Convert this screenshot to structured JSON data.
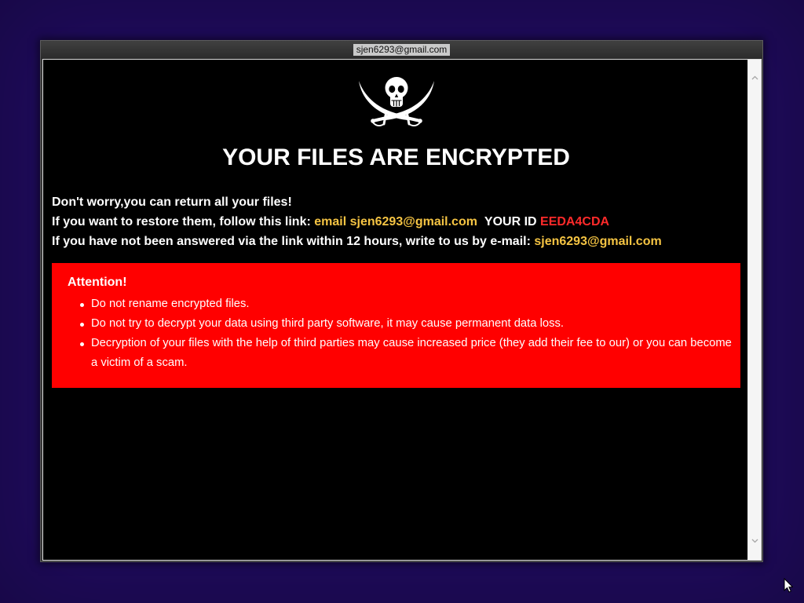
{
  "window": {
    "title": "sjen6293@gmail.com"
  },
  "note": {
    "icon": "skull-crossed-sabers-icon",
    "heading": "YOUR FILES ARE ENCRYPTED",
    "intro": {
      "line1": "Don't worry,you can return all your files!",
      "line2_prefix": "If you want to restore them, follow this link:",
      "line2_link": "email sjen6293@gmail.com",
      "id_label": "YOUR ID",
      "id_value": "EEDA4CDA",
      "line3_prefix": "If you have not been answered via the link within 12 hours, write to us by e-mail:",
      "line3_email": "sjen6293@gmail.com"
    },
    "attention": {
      "title": "Attention!",
      "items": [
        "Do not rename encrypted files.",
        "Do not try to decrypt your data using third party software, it may cause permanent data loss.",
        "Decryption of your files with the help of third parties may cause increased price (they add their fee to our) or you can become a victim of a scam."
      ]
    }
  },
  "scrollbar": {
    "up_icon": "chevron-up-icon",
    "down_icon": "chevron-down-icon"
  },
  "cursor": {
    "icon": "mouse-cursor-icon"
  },
  "colors": {
    "desktop_background": "#1f0b5c",
    "note_background": "#000000",
    "link_gold": "#f5c443",
    "id_red": "#ff2a2a",
    "attention_background": "#ff0000"
  }
}
